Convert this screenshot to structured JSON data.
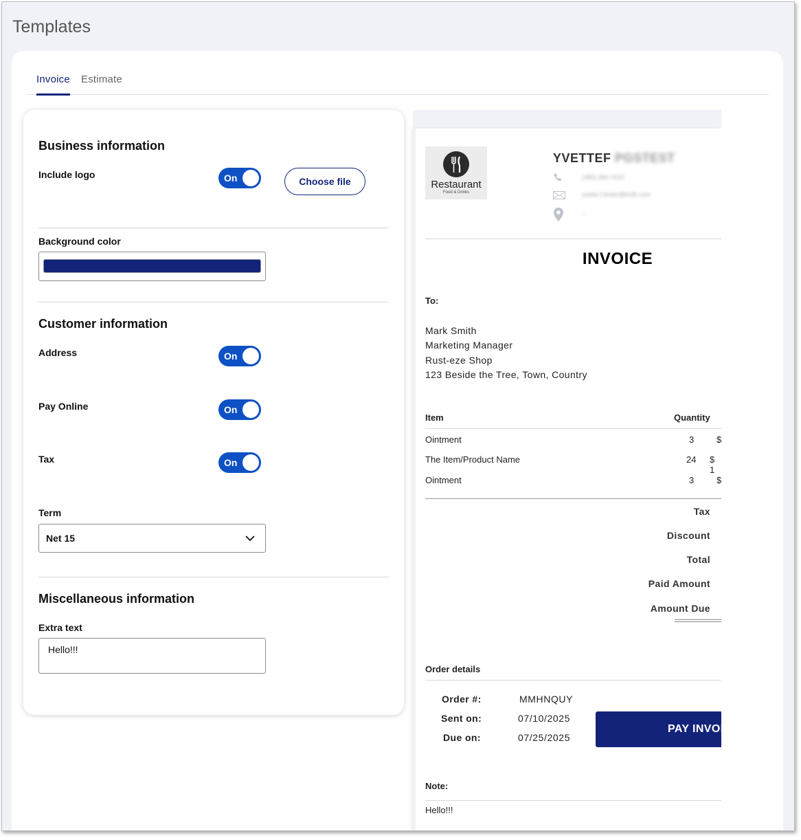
{
  "page": {
    "title": "Templates"
  },
  "tabs": [
    {
      "label": "Invoice",
      "active": true
    },
    {
      "label": "Estimate",
      "active": false
    }
  ],
  "settings": {
    "business": {
      "title": "Business information",
      "include_logo_label": "Include logo",
      "include_logo_toggle": "On",
      "choose_file_label": "Choose file",
      "background_color_label": "Background color",
      "background_color": "#13237a"
    },
    "customer": {
      "title": "Customer information",
      "address_label": "Address",
      "address_toggle": "On",
      "pay_online_label": "Pay Online",
      "pay_online_toggle": "On",
      "tax_label": "Tax",
      "tax_toggle": "On",
      "term_label": "Term",
      "term_value": "Net 15"
    },
    "misc": {
      "title": "Miscellaneous information",
      "extra_text_label": "Extra text",
      "extra_text_value": "Hello!!!"
    }
  },
  "preview": {
    "logo": {
      "name": "Restaurant",
      "tagline": "Food & Drinks"
    },
    "business_name": "YVETTEF",
    "business_name_blurred": "PGSTEST",
    "phone_blurred": "(480) 366-7033",
    "email_blurred": "yvette.f.tester@bofb.com",
    "address_blurred": "--",
    "invoice_title": "INVOICE",
    "to_label": "To:",
    "recipient": {
      "name": "Mark Smith",
      "title": "Marketing Manager",
      "company": "Rust-eze Shop",
      "address": "123 Beside the Tree, Town, Country"
    },
    "items_header": {
      "item": "Item",
      "quantity": "Quantity"
    },
    "items": [
      {
        "name": "Ointment",
        "quantity": "3",
        "price": "$"
      },
      {
        "name": "The Item/Product Name",
        "quantity": "24",
        "price": "$ 1"
      },
      {
        "name": "Ointment",
        "quantity": "3",
        "price": "$"
      }
    ],
    "totals": {
      "tax": "Tax",
      "discount": "Discount",
      "total": "Total",
      "paid_amount": "Paid Amount",
      "amount_due": "Amount Due"
    },
    "order": {
      "title": "Order details",
      "order_no_label": "Order #:",
      "order_no": "MMHNQUY",
      "sent_label": "Sent on:",
      "sent": "07/10/2025",
      "due_label": "Due on:",
      "due": "07/25/2025"
    },
    "pay_button": "PAY INVOICE",
    "note_label": "Note:",
    "note_text": "Hello!!!"
  },
  "colors": {
    "accent": "#13257a",
    "toggle": "#0d51c4",
    "pay_button": "#13237a"
  }
}
